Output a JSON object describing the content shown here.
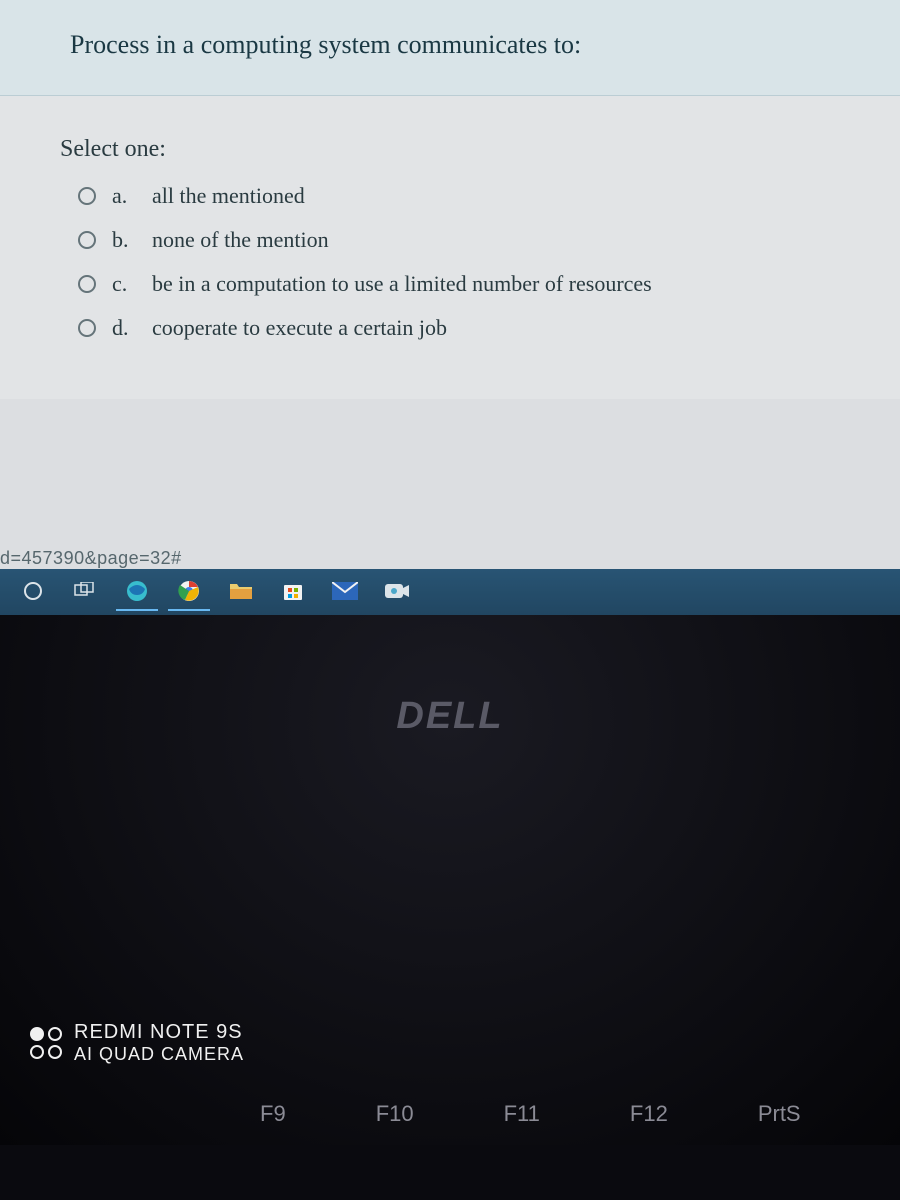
{
  "question": {
    "prompt": "Process in a computing system communicates to:",
    "instruction": "Select one:",
    "options": [
      {
        "letter": "a.",
        "text": "all the mentioned"
      },
      {
        "letter": "b.",
        "text": "none of the mention"
      },
      {
        "letter": "c.",
        "text": "be in a computation to use a limited number of resources"
      },
      {
        "letter": "d.",
        "text": "cooperate to execute a certain job"
      }
    ]
  },
  "url_fragment": "d=457390&page=32#",
  "monitor_brand": "DELL",
  "watermark": {
    "line1": "REDMI NOTE 9S",
    "line2": "AI QUAD CAMERA"
  },
  "fn_keys": [
    "F9",
    "F10",
    "F11",
    "F12",
    "PrtS"
  ]
}
